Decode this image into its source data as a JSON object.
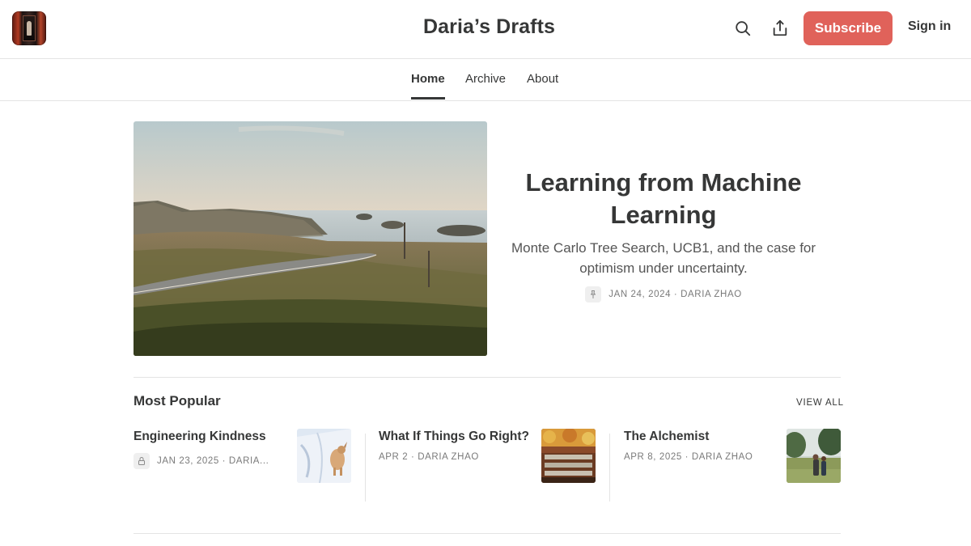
{
  "header": {
    "site_title": "Daria’s Drafts",
    "subscribe_label": "Subscribe",
    "signin_label": "Sign in",
    "icons": [
      "search-icon",
      "share-icon"
    ],
    "accent_color": "#e0625a"
  },
  "nav": {
    "tabs": [
      {
        "label": "Home",
        "active": true
      },
      {
        "label": "Archive",
        "active": false
      },
      {
        "label": "About",
        "active": false
      }
    ]
  },
  "hero": {
    "title": "Learning from Machine Learning",
    "subtitle": "Monte Carlo Tree Search, UCB1, and the case for optimism under uncertainty.",
    "meta": "JAN 24, 2024 · DARIA ZHAO",
    "pinned_icon": "pin-icon"
  },
  "popular": {
    "section_title": "Most Popular",
    "view_all_label": "VIEW ALL",
    "posts": [
      {
        "title": "Engineering Kindness",
        "meta": "JAN 23, 2025 · DARIA...",
        "locked": true
      },
      {
        "title": "What If Things Go Right?",
        "meta": "APR 2 · DARIA ZHAO",
        "locked": false
      },
      {
        "title": "The Alchemist",
        "meta": "APR 8, 2025 · DARIA ZHAO",
        "locked": false
      }
    ]
  }
}
